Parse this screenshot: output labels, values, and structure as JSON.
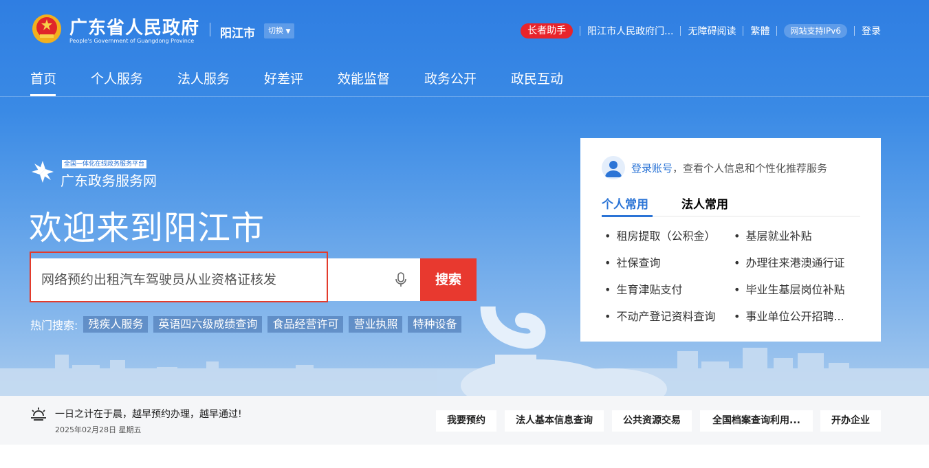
{
  "header": {
    "gov_title": "广东省人民政府",
    "gov_subtitle": "People's Government of Guangdong Province",
    "city": "阳江市",
    "switch_label": "切换",
    "elder_assistant": "长者助手",
    "portal_link": "阳江市人民政府门...",
    "accessibility": "无障碍阅读",
    "traditional": "繁體",
    "ipv6": "网站支持IPv6",
    "login": "登录"
  },
  "nav": {
    "items": [
      "首页",
      "个人服务",
      "法人服务",
      "好差评",
      "效能监督",
      "政务公开",
      "政民互动"
    ],
    "active_index": 0
  },
  "hero": {
    "platform_tag": "全国一体化在线政务服务平台",
    "platform_name": "广东政务服务网",
    "welcome": "欢迎来到阳江市",
    "search": {
      "placeholder": "网络预约出租汽车驾驶员从业资格证核发",
      "button_label": "搜索"
    },
    "hot": {
      "label": "热门搜索:",
      "tags": [
        "残疾人服务",
        "英语四六级成绩查询",
        "食品经营许可",
        "营业执照",
        "特种设备"
      ]
    }
  },
  "card": {
    "login_link": "登录账号",
    "login_rest": "，查看个人信息和个性化推荐服务",
    "tabs": [
      "个人常用",
      "法人常用"
    ],
    "active_tab": 0,
    "items": [
      "租房提取（公积金）",
      "基层就业补贴",
      "社保查询",
      "办理往来港澳通行证",
      "生育津贴支付",
      "毕业生基层岗位补贴",
      "不动产登记资料查询",
      "事业单位公开招聘..."
    ]
  },
  "bottom": {
    "motto": "一日之计在于晨，越早预约办理，越早通过!",
    "date": "2025年02月28日 星期五",
    "quick_links": [
      "我要预约",
      "法人基本信息查询",
      "公共资源交易",
      "全国档案查询利用...",
      "开办企业"
    ]
  },
  "colors": {
    "brand_blue": "#2b74d6",
    "search_red": "#e8392f",
    "elder_red": "#e8242b",
    "highlight_red": "#e33b2c"
  },
  "icons": [
    "emblem-icon",
    "platform-logo-icon",
    "chevron-down-icon",
    "microphone-icon",
    "user-avatar-icon",
    "sunrise-icon"
  ]
}
